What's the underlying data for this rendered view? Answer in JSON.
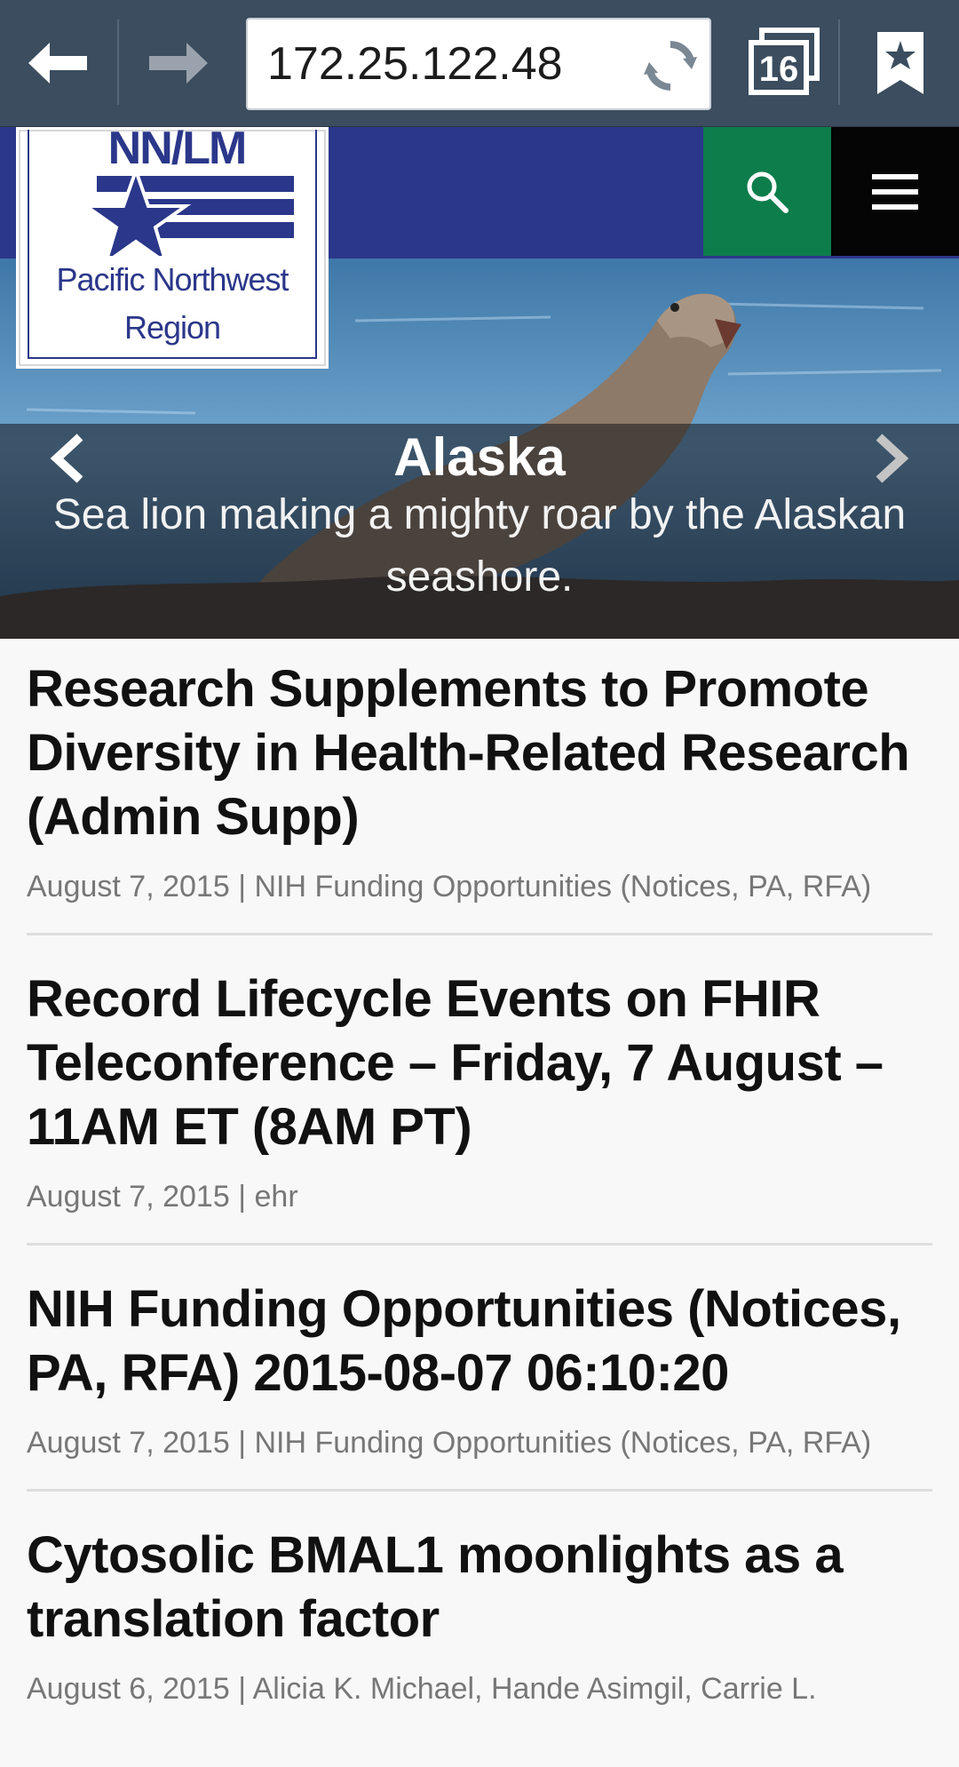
{
  "browser": {
    "url": "172.25.122.48",
    "tab_count": "16"
  },
  "site": {
    "logo_acronym": "NN/LM",
    "logo_line1": "Pacific Northwest",
    "logo_line2": "Region",
    "header_color": "#2b378a",
    "search_color": "#0d7d4b"
  },
  "slide": {
    "title": "Alaska",
    "caption": "Sea lion making a mighty roar by the Alaskan seashore."
  },
  "articles": [
    {
      "title": "Research Supplements to Promote Diversity in Health-Related Research (Admin Supp)",
      "date": "August 7, 2015",
      "separator": "|",
      "category": "NIH Funding Opportunities (Notices, PA, RFA)"
    },
    {
      "title": "Record Lifecycle Events on FHIR Teleconference – Friday, 7 August – 11AM ET (8AM PT)",
      "date": "August 7, 2015",
      "separator": "|",
      "category": "ehr"
    },
    {
      "title": "NIH Funding Opportunities (Notices, PA, RFA) 2015-08-07 06:10:20",
      "date": "August 7, 2015",
      "separator": "|",
      "category": "NIH Funding Opportunities (Notices, PA, RFA)"
    },
    {
      "title": "Cytosolic BMAL1 moonlights as a translation factor",
      "date": "August 6, 2015",
      "separator": "|",
      "category": "Alicia K. Michael, Hande Asimgil, Carrie L."
    }
  ]
}
